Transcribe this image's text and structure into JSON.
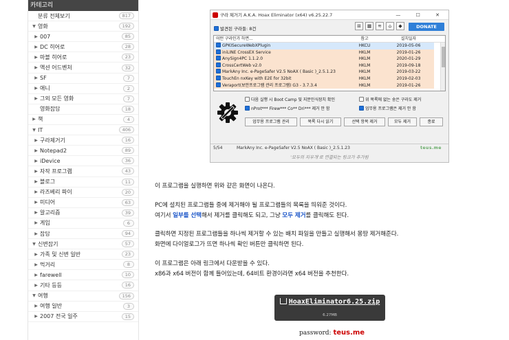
{
  "sidebar": {
    "header": "카테고리",
    "items": [
      {
        "label": "분류 전체보기",
        "count": "817",
        "level": 0,
        "arrow": ""
      },
      {
        "label": "영화",
        "count": "192",
        "level": 0,
        "arrow": "▼"
      },
      {
        "label": "007",
        "count": "85",
        "level": 1,
        "arrow": "▶"
      },
      {
        "label": "DC 히어로",
        "count": "28",
        "level": 1,
        "arrow": "▶"
      },
      {
        "label": "마블 히어로",
        "count": "23",
        "level": 1,
        "arrow": "▶"
      },
      {
        "label": "액션 어드벤처",
        "count": "32",
        "level": 1,
        "arrow": "▶"
      },
      {
        "label": "SF",
        "count": "7",
        "level": 1,
        "arrow": "▶"
      },
      {
        "label": "애니",
        "count": "2",
        "level": 1,
        "arrow": "▶"
      },
      {
        "label": "그외 모든 영화",
        "count": "7",
        "level": 1,
        "arrow": "▶"
      },
      {
        "label": "영화잡담",
        "count": "18",
        "level": 1,
        "arrow": ""
      },
      {
        "label": "책",
        "count": "4",
        "level": 0,
        "arrow": "▶"
      },
      {
        "label": "IT",
        "count": "406",
        "level": 0,
        "arrow": "▼"
      },
      {
        "label": "구라제거기",
        "count": "16",
        "level": 1,
        "arrow": "▶"
      },
      {
        "label": "Notepad2",
        "count": "89",
        "level": 1,
        "arrow": "▶"
      },
      {
        "label": "iDevice",
        "count": "36",
        "level": 1,
        "arrow": "▶"
      },
      {
        "label": "자작 프로그램",
        "count": "43",
        "level": 1,
        "arrow": "▶"
      },
      {
        "label": "블로그",
        "count": "11",
        "level": 1,
        "arrow": "▶"
      },
      {
        "label": "라즈베리 파이",
        "count": "20",
        "level": 1,
        "arrow": "▶"
      },
      {
        "label": "미디어",
        "count": "63",
        "level": 1,
        "arrow": "▶"
      },
      {
        "label": "알고리즘",
        "count": "39",
        "level": 1,
        "arrow": "▶"
      },
      {
        "label": "게임",
        "count": "6",
        "level": 1,
        "arrow": "▶"
      },
      {
        "label": "잡담",
        "count": "94",
        "level": 1,
        "arrow": "▶"
      },
      {
        "label": "신변잡기",
        "count": "57",
        "level": 0,
        "arrow": "▼"
      },
      {
        "label": "가족 및 신변 일반",
        "count": "23",
        "level": 1,
        "arrow": "▶"
      },
      {
        "label": "먹거리",
        "count": "8",
        "level": 1,
        "arrow": "▶"
      },
      {
        "label": "farewell",
        "count": "10",
        "level": 1,
        "arrow": "▶"
      },
      {
        "label": "기타 등등",
        "count": "16",
        "level": 1,
        "arrow": "▶"
      },
      {
        "label": "여행",
        "count": "156",
        "level": 0,
        "arrow": "▼"
      },
      {
        "label": "여행 일반",
        "count": "3",
        "level": 1,
        "arrow": "▶"
      },
      {
        "label": "2007 전국 일주",
        "count": "15",
        "level": 1,
        "arrow": "▶"
      }
    ]
  },
  "screenshot": {
    "title": "구라 제거기 A.K.A. Hoax Eliminator (x64) v6.25.22.7",
    "window_controls": "— ☐ ✕",
    "found": "발견된 구라들: 8건",
    "donate": "DONATE",
    "top_icons": [
      "⊞",
      "▦",
      "≋",
      "⌂",
      "◆"
    ],
    "columns": [
      "어떤 구라인가 하면...",
      "참고",
      "설치일자"
    ],
    "rows": [
      {
        "name": "GPKISecureWebXPlugin",
        "ref": "HKCU",
        "date": "2019-05-06",
        "color": "blue"
      },
      {
        "name": "iniLINE CrossEX Service",
        "ref": "HKLM",
        "date": "2019-01-26",
        "color": "orange"
      },
      {
        "name": "AnySign4PC 1.1.2.0",
        "ref": "HKLM",
        "date": "2020-01-29",
        "color": "orange"
      },
      {
        "name": "CrossCertWeb v2.0",
        "ref": "HKLM",
        "date": "2019-09-18",
        "color": "orange"
      },
      {
        "name": "MarkAny Inc. e-PageSafer V2.5 NoAX ( Basic )_2.5.1.23",
        "ref": "HKLM",
        "date": "2019-03-22",
        "color": "orange"
      },
      {
        "name": "TouchEn nxKey with E2E for 32bit",
        "ref": "HKLM",
        "date": "2019-02-03",
        "color": "orange"
      },
      {
        "name": "Veraport(보안프로그램 관리 프로그램) G3 - 3.7.3.4",
        "ref": "HKLM",
        "date": "2019-01-26",
        "color": "orange"
      }
    ],
    "options": {
      "boot_camp": "다음 실행 시 Boot Camp 및 지문인식장치 확인",
      "nprot": "nProt*** Firew*** Co** Dri*** 제거 안 함",
      "list_delete": "위 목록에 없는 숭은 구라도 제거",
      "work_delete": "업무용 프로그램은 제거 안 함"
    },
    "buttons": [
      "업무용 프로그램 관리",
      "목록 다시 읽기",
      "선택 항목 제거",
      "모두 제거",
      "종료"
    ],
    "status_count": "5/54",
    "status_text": "MarkAny Inc. e-PageSafer V2.5 NoAX ( Basic )_2.5.1.23",
    "status_logo": "teus.me",
    "caption": "'모두의 지우개'로 연결되는 링크가 추가됨"
  },
  "article": {
    "p1": "이 프로그램을 실행하면 위와 같은 화면이 나온다.",
    "p2": "PC에 설치된 프로그램들 중에 제거해야 될 프로그램들의 목록을 띄워준 것이다.",
    "p3_a": "여기서 ",
    "p3_link1": "일부를 선택",
    "p3_b": "해서 제거를 클릭해도 되고, 그냥 ",
    "p3_link2": "모두 제거",
    "p3_c": "를 클릭해도 된다.",
    "p4": "클릭하면 지정된 프로그램들을 하나씩 제거할 수 있는 배치 파일을 만들고 실행해서 몽땅 제거해준다.",
    "p5": "화면에 다이얼로그가 뜨면 하나씩 확인 버튼만 클릭하면 된다.",
    "p6": "이 프로그램은 아래 링크에서 다운받을 수 있다.",
    "p7": "x86과 x64 버전이 함께 들어있는데, 64비트 환경이라면 x64 버전을 추천한다."
  },
  "download": {
    "name": "HoaxEliminator6.25.zip",
    "size": "6.27MB"
  },
  "password": {
    "label": "password: ",
    "value": "teus.me"
  }
}
